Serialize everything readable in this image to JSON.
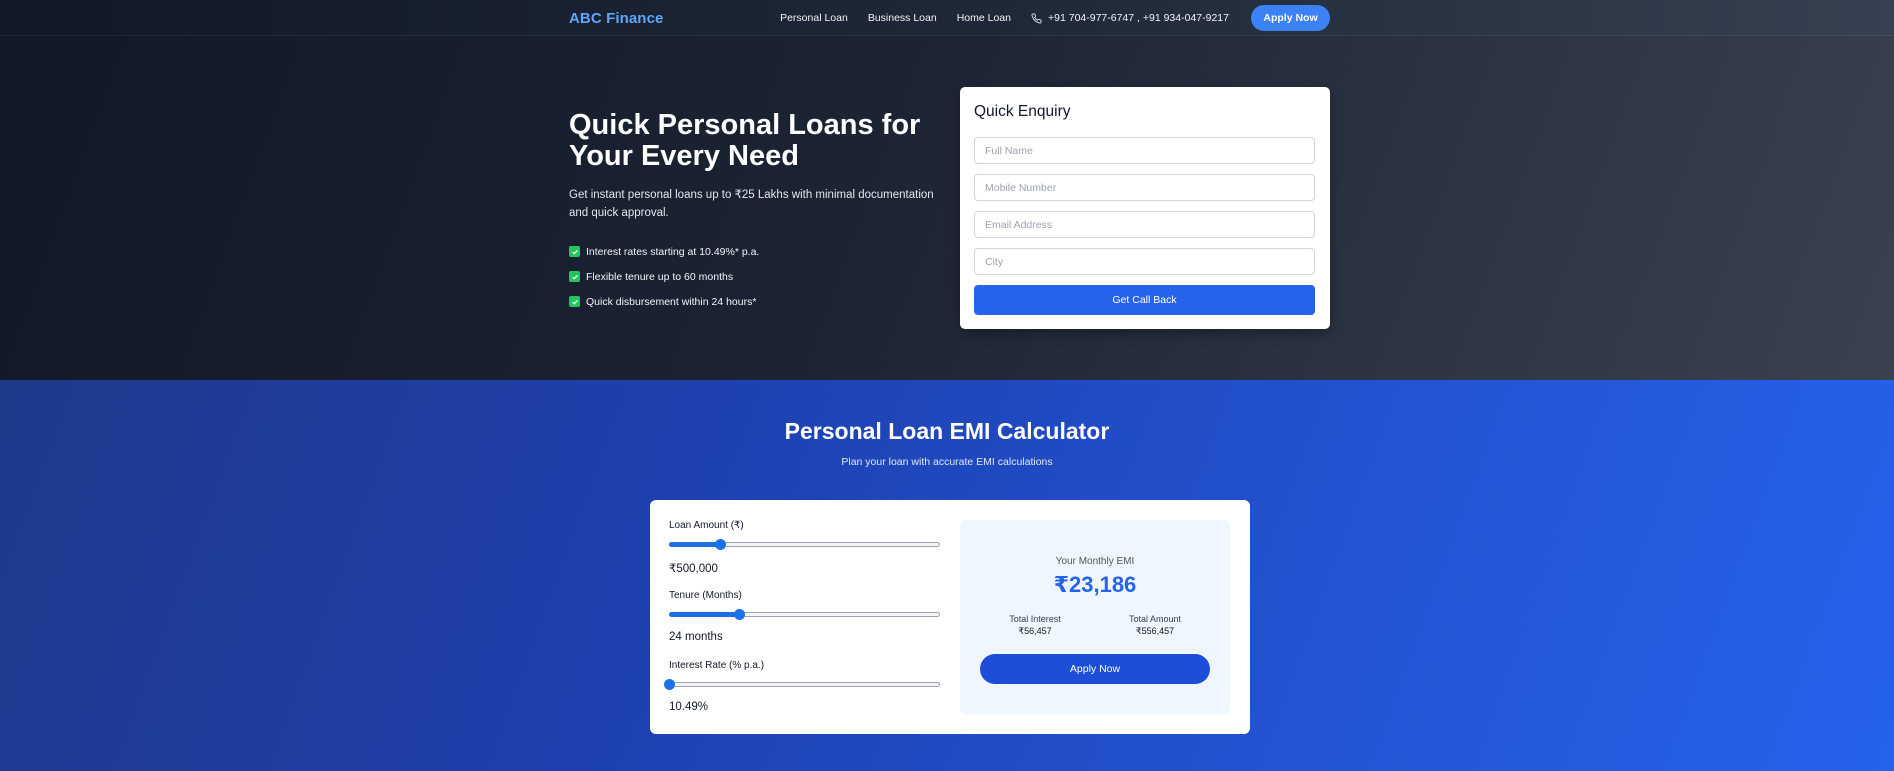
{
  "nav": {
    "brand": "ABC Finance",
    "links": [
      "Personal Loan",
      "Business Loan",
      "Home Loan"
    ],
    "phone": "+91 704-977-6747 , +91 934-047-9217",
    "apply_label": "Apply Now"
  },
  "hero": {
    "title": "Quick Personal Loans for Your Every Need",
    "subtitle": "Get instant personal loans up to ₹25 Lakhs with minimal documentation and quick approval.",
    "features": [
      "Interest rates starting at 10.49%* p.a.",
      "Flexible tenure up to 60 months",
      "Quick disbursement within 24 hours*"
    ]
  },
  "enquiry": {
    "title": "Quick Enquiry",
    "fields": [
      {
        "placeholder": "Full Name",
        "value": ""
      },
      {
        "placeholder": "Mobile Number",
        "value": ""
      },
      {
        "placeholder": "Email Address",
        "value": ""
      },
      {
        "placeholder": "City",
        "value": ""
      }
    ],
    "submit_label": "Get Call Back"
  },
  "calculator": {
    "title": "Personal Loan EMI Calculator",
    "subtitle": "Plan your loan with accurate EMI calculations",
    "loan_amount": {
      "label": "Loan Amount (₹)",
      "display": "₹500,000",
      "fraction": 0.19
    },
    "tenure": {
      "label": "Tenure (Months)",
      "display": "24 months",
      "fraction": 0.26
    },
    "interest": {
      "label": "Interest Rate (% p.a.)",
      "display": "10.49%",
      "fraction": 0.0
    },
    "result": {
      "emi_label": "Your Monthly EMI",
      "emi_value": "₹23,186",
      "total_interest_label": "Total Interest",
      "total_interest_value": "₹56,457",
      "total_amount_label": "Total Amount",
      "total_amount_value": "₹556,457",
      "apply_label": "Apply Now"
    }
  },
  "colors": {
    "brand": "#60a5fa",
    "primary": "#2563eb",
    "check": "#22c55e"
  }
}
